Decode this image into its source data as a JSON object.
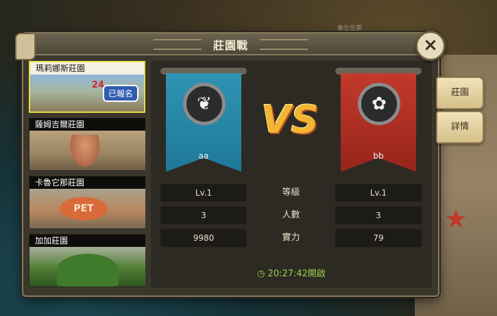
{
  "watermark": "衆生伍萊",
  "panel": {
    "title": "莊園戰"
  },
  "close": {
    "icon": "×"
  },
  "manors": [
    {
      "name": "瑪莉娜斯莊園",
      "selected": true,
      "badge": "已報名",
      "sign_number": "24"
    },
    {
      "name": "薩姆吉爾莊園",
      "selected": false
    },
    {
      "name": "卡魯它那莊園",
      "selected": false,
      "sign_text": "PET"
    },
    {
      "name": "加加莊園",
      "selected": false
    }
  ],
  "battle": {
    "vs_text": "VS",
    "left": {
      "name": "aa",
      "color": "#1f7898",
      "emblem_icon": "❦",
      "level": "Lv.1",
      "members": "3",
      "power": "9980"
    },
    "right": {
      "name": "bb",
      "color": "#97241b",
      "emblem_icon": "✿",
      "level": "Lv.1",
      "members": "3",
      "power": "79"
    },
    "labels": {
      "level": "等級",
      "members": "人數",
      "power": "實力"
    },
    "open_time": "20:27:42開啟",
    "clock_icon": "◷"
  },
  "side_tabs": [
    {
      "label": "莊園"
    },
    {
      "label": "詳情"
    }
  ]
}
